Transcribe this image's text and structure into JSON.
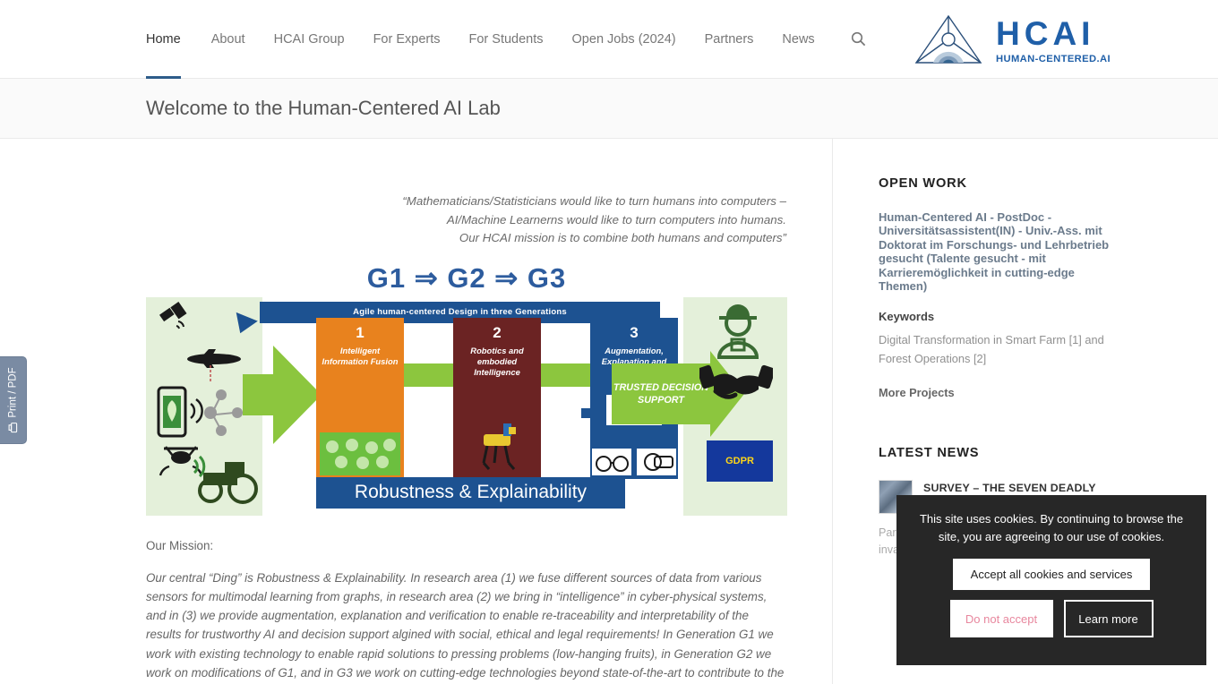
{
  "site": {
    "logo_title": "HCAI",
    "logo_subtitle": "HUMAN-CENTERED.AI",
    "logo_icon": "hcai-eye-triangle-logo"
  },
  "nav": {
    "items": [
      {
        "label": "Home",
        "active": true
      },
      {
        "label": "About",
        "active": false
      },
      {
        "label": "HCAI Group",
        "active": false
      },
      {
        "label": "For Experts",
        "active": false
      },
      {
        "label": "For Students",
        "active": false
      },
      {
        "label": "Open Jobs (2024)",
        "active": false
      },
      {
        "label": "Partners",
        "active": false
      },
      {
        "label": "News",
        "active": false
      }
    ],
    "search_icon": "search-icon"
  },
  "page": {
    "title": "Welcome to the Human-Centered AI Lab"
  },
  "quote": {
    "line1": "“Mathematicians/Statisticians would like to turn humans into computers –",
    "line2": "AI/Machine Learnerns would like to turn computers into humans.",
    "line3": "Our HCAI mission is to combine both humans and computers”"
  },
  "diagram": {
    "title": "G1 ⇒ G2 ⇒ G3",
    "agile_banner": "Agile human-centered Design in three Generations",
    "boxes": [
      {
        "num": "1",
        "label": "Intelligent Information Fusion",
        "color": "#e8821e"
      },
      {
        "num": "2",
        "label": "Robotics and embodied Intelligence",
        "color": "#6b2323"
      },
      {
        "num": "3",
        "label": "Augmentation, Explanation and Verification",
        "color": "#1d5291"
      }
    ],
    "trusted": "TRUSTED DECISION SUPPORT",
    "footer_banner": "Robustness & Explainability",
    "gdpr_label": "GDPR",
    "left_icons": [
      "satellite-icon",
      "airplane-icon",
      "smartphone-leaf-icon",
      "drone-icon",
      "tractor-icon"
    ],
    "right_icons": [
      "farmer-person-icon",
      "handshake-icon",
      "gdpr-flag-icon"
    ]
  },
  "mission": {
    "label": "Our Mission:",
    "body": "Our central “Ding” is Robustness & Explainability. In research area (1) we fuse different sources of data from various sensors for multimodal learning from graphs, in research area (2) we bring in “intelligence” in cyber-physical systems, and in (3) we provide augmentation, explanation and verification to enable re-traceability and interpretability of the results for trustworthy AI and decision support algined with social, ethical and legal requirements! In Generation G1 we work with existing technology to enable rapid solutions to pressing problems (low-hanging fruits), in Generation G2 we work on modifications of G1, and in G3 we work on cutting-edge technologies beyond state-of-the-art to contribute to the"
  },
  "sidebar": {
    "open_work": {
      "heading": "OPEN WORK",
      "job_title": "Human-Centered AI - PostDoc - Universitätsassistent(IN) - Univ.-Ass. mit Doktorat im Forschungs- und Lehrbetrieb gesucht (Talente gesucht - mit Karrieremöglichkeit in cutting-edge Themen)",
      "keywords_label": "Keywords",
      "keywords_value": "Digital Transformation in Smart Farm [1] and Forest Operations [2]",
      "more_projects": "More Projects"
    },
    "latest_news": {
      "heading": "LATEST NEWS",
      "items": [
        {
          "title": "SURVEY – THE SEVEN DEADLY SINS OF AI IN MEDICINE",
          "excerpt": "Participate in our survey ethical challenges are invaluable in",
          "thumb": "news-thumbnail"
        }
      ]
    }
  },
  "print_widget": {
    "label": "Print / PDF",
    "icon": "printer-icon"
  },
  "cookie_banner": {
    "message": "This site uses cookies. By continuing to browse the site, you are agreeing to our use of cookies.",
    "accept_label": "Accept all cookies and services",
    "deny_label": "Do not accept",
    "learn_label": "Learn more"
  },
  "colors": {
    "brand_blue": "#1f5fa8",
    "diagram_blue": "#1d5291",
    "green": "#8cc63e",
    "orange": "#e8821e",
    "dark_red": "#6b2323",
    "cookie_bg": "#272727",
    "deny_pink": "#e8879e"
  }
}
